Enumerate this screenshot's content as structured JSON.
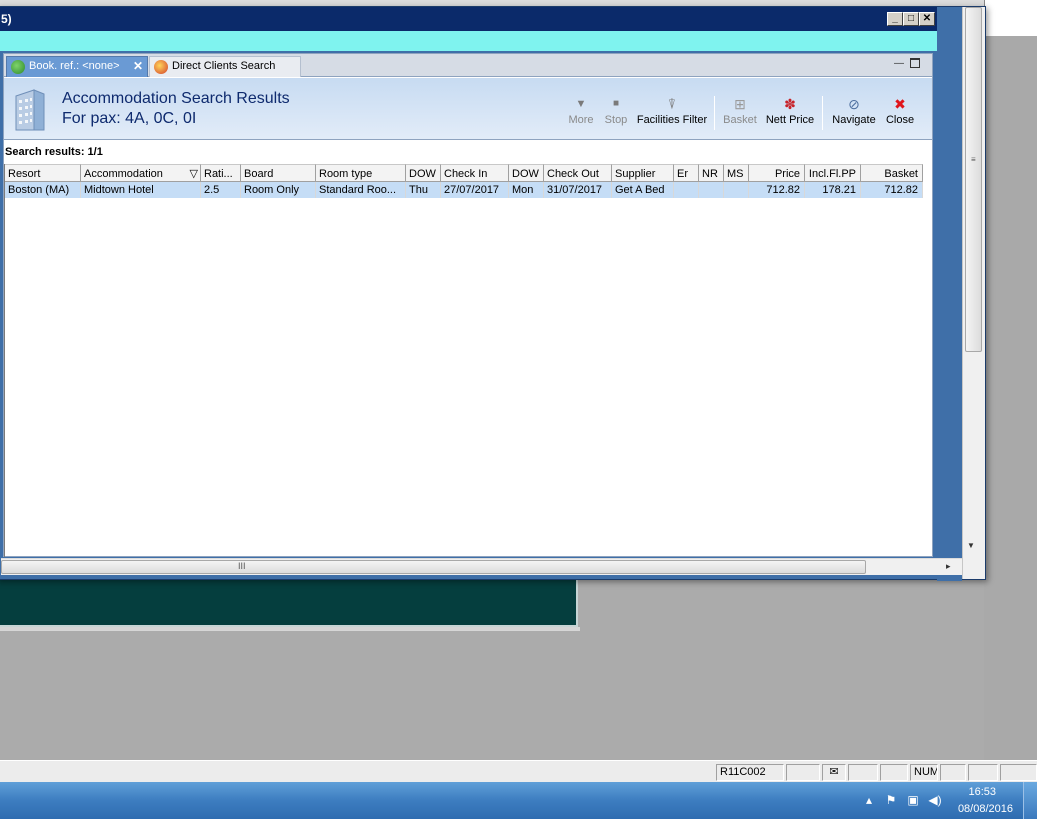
{
  "window": {
    "title_fragment": "5)",
    "min_glyph": "_",
    "max_glyph": "□",
    "close_glyph": "✕"
  },
  "tabs": [
    {
      "label": "Book. ref.: <none>",
      "close": "✕",
      "active": true
    },
    {
      "label": "Direct Clients Search",
      "active": false
    }
  ],
  "header": {
    "title": "Accommodation Search Results",
    "pax": "For pax: 4A, 0C, 0I"
  },
  "toolbar": {
    "more": {
      "label": "More",
      "glyph": "▼",
      "enabled": false
    },
    "stop": {
      "label": "Stop",
      "glyph": "■",
      "enabled": false
    },
    "facilities_filter": {
      "label": "Facilities Filter",
      "glyph": "⍒",
      "enabled": true
    },
    "basket": {
      "label": "Basket",
      "glyph": "⊞",
      "enabled": false
    },
    "nett_price": {
      "label": "Nett Price",
      "glyph": "✽",
      "enabled": true
    },
    "navigate": {
      "label": "Navigate",
      "glyph": "⊘",
      "enabled": true
    },
    "close": {
      "label": "Close",
      "glyph": "✖",
      "enabled": true
    }
  },
  "results": {
    "label": "Search results: 1/1",
    "columns": [
      "Resort",
      "Accommodation",
      "Rati...",
      "Board",
      "Room type",
      "DOW",
      "Check In",
      "DOW",
      "Check Out",
      "Supplier",
      "Er",
      "NR",
      "MS",
      "Price",
      "Incl.Fl.PP",
      "Basket"
    ],
    "filter_glyph": "▽",
    "rows": [
      [
        "Boston (MA)",
        "Midtown Hotel",
        "2.5",
        "Room Only",
        "Standard Roo...",
        "Thu",
        "27/07/2017",
        "Mon",
        "31/07/2017",
        "Get A Bed",
        "",
        "",
        "",
        "712.82",
        "178.21",
        "712.82"
      ]
    ]
  },
  "scroll": {
    "grip_h": "III",
    "grip_v": "≡",
    "arrow_right": "▸",
    "arrow_down": "▼"
  },
  "statusbar": {
    "cell_code": "R11C002",
    "num": "NUM"
  },
  "taskbar": {
    "time": "16:53",
    "date": "08/08/2016"
  },
  "colors": {
    "title_bar": "#0b2a6a",
    "cyan_bar": "#7ff3ef",
    "header_text": "#0e2a6e",
    "selected_row": "#c5ddf6",
    "close_red": "#e0151b"
  }
}
